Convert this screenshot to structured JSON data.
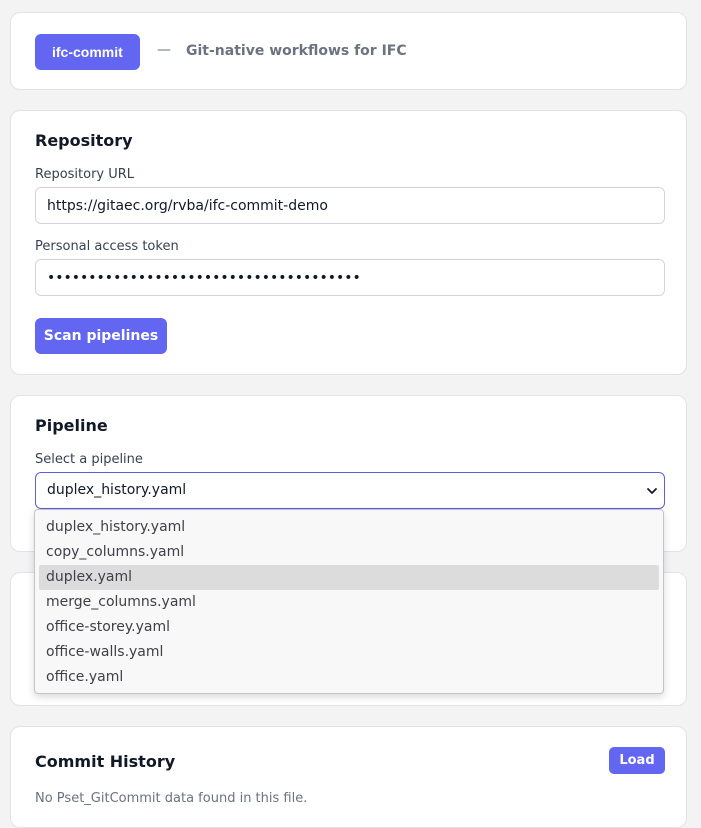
{
  "header": {
    "brand": "ifc-commit",
    "separator": "—",
    "tagline": "Git-native workflows for IFC"
  },
  "repository": {
    "title": "Repository",
    "url_label": "Repository URL",
    "url_value": "https://gitaec.org/rvba/ifc-commit-demo",
    "token_label": "Personal access token",
    "token_value": "••••••••••••••••••••••••••••••••••••••",
    "scan_button": "Scan pipelines"
  },
  "pipeline": {
    "title": "Pipeline",
    "select_label": "Select a pipeline",
    "selected": "duplex_history.yaml",
    "options": [
      "duplex_history.yaml",
      "copy_columns.yaml",
      "duplex.yaml",
      "merge_columns.yaml",
      "office-storey.yaml",
      "office-walls.yaml",
      "office.yaml"
    ],
    "highlighted_index": 2
  },
  "history": {
    "title": "Commit History",
    "load_button": "Load",
    "empty_message": "No Pset_GitCommit data found in this file."
  },
  "colors": {
    "accent": "#6366f1",
    "background": "#f3f3f4",
    "card": "#ffffff"
  },
  "icons": {
    "select_chevron": "chevron-down-icon"
  }
}
